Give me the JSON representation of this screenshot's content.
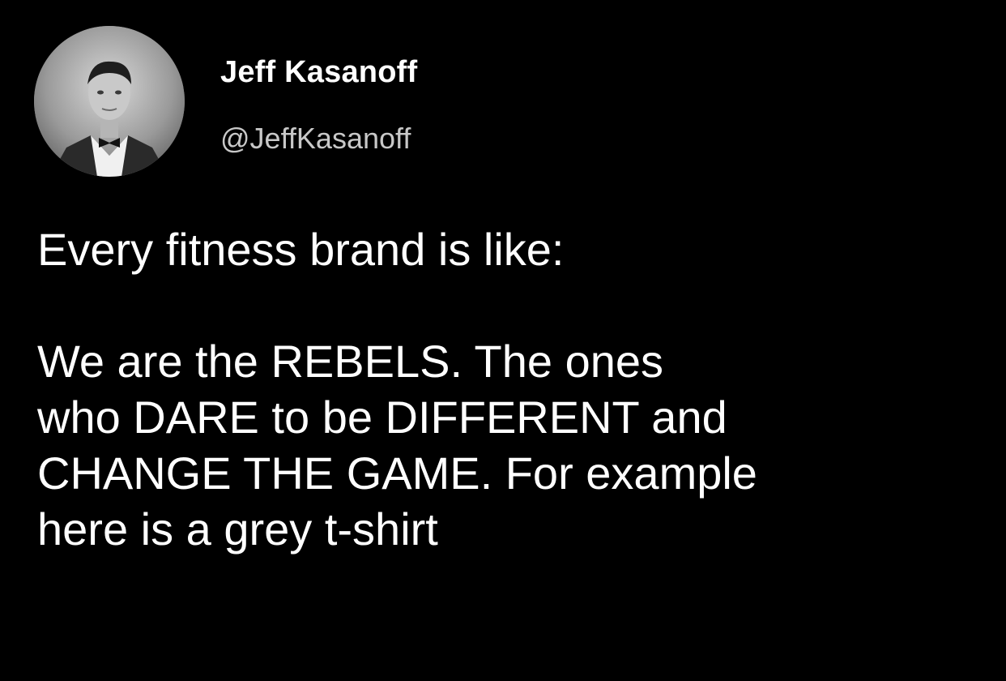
{
  "tweet": {
    "author": {
      "display_name": "Jeff Kasanoff",
      "handle": "@JeffKasanoff",
      "avatar_icon": "profile-photo-avatar"
    },
    "text": {
      "line1": "Every fitness brand is like:",
      "line2": "We are the REBELS. The ones",
      "line3": "who DARE to be DIFFERENT and",
      "line4": "CHANGE THE GAME. For example",
      "line5": "here is a grey t-shirt"
    }
  },
  "colors": {
    "background": "#000000",
    "text": "#ffffff",
    "handle": "#c8c8c8"
  }
}
